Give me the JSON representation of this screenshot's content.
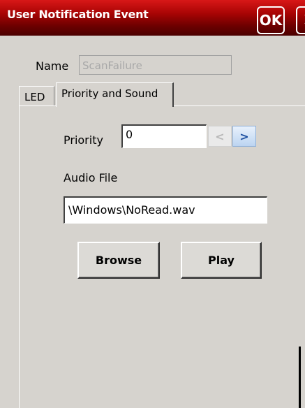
{
  "window": {
    "title": "User Notification Event",
    "ok_label": "OK",
    "close_glyph": "✕"
  },
  "name": {
    "label": "Name",
    "value": "ScanFailure"
  },
  "tabs": [
    {
      "label": "LED",
      "active": false
    },
    {
      "label": "Priority and Sound",
      "active": true
    }
  ],
  "priority": {
    "label": "Priority",
    "value": "0",
    "left_arrow": "<",
    "right_arrow": ">"
  },
  "audio": {
    "label": "Audio File",
    "value": "\\Windows\\NoRead.wav"
  },
  "buttons": {
    "browse_label": "Browse",
    "play_label": "Play"
  },
  "colors": {
    "titlebar": "#a80404",
    "dialog_bg": "#d6d3ce",
    "spin_accent": "#1d4fa0"
  },
  "icons": {
    "close": "close-icon",
    "spin_left": "chevron-left-icon",
    "spin_right": "chevron-right-icon"
  }
}
